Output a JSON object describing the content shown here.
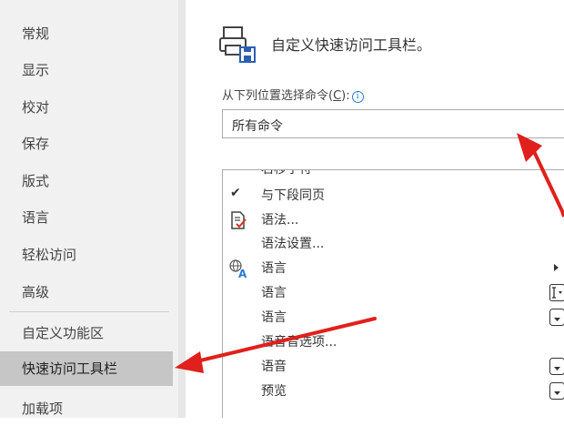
{
  "sidebar": {
    "items": [
      {
        "label": "常规"
      },
      {
        "label": "显示"
      },
      {
        "label": "校对"
      },
      {
        "label": "保存"
      },
      {
        "label": "版式"
      },
      {
        "label": "语言"
      },
      {
        "label": "轻松访问"
      },
      {
        "label": "高级"
      },
      {
        "label": "自定义功能区"
      },
      {
        "label": "快速访问工具栏",
        "selected": true
      },
      {
        "label": "加载项"
      }
    ]
  },
  "main": {
    "section_title": "自定义快速访问工具栏。",
    "choose_label": "从下列位置选择命令(C):",
    "choose_label_prefix": "从下列位置选择命令(",
    "choose_label_key": "C",
    "choose_label_suffix": "):",
    "dropdown_value": "所有命令",
    "commands": [
      {
        "label": "右移字符"
      },
      {
        "label": "与下段同页",
        "checked": true
      },
      {
        "label": "语法...",
        "icon": "grammar-icon"
      },
      {
        "label": "语法设置..."
      },
      {
        "label": "语言",
        "icon": "language-icon",
        "submenu": true
      },
      {
        "label": "语言",
        "control": "text-cursor-dropdown"
      },
      {
        "label": "语言",
        "control": "dropdown"
      },
      {
        "label": "语音音选项..."
      },
      {
        "label": "语音",
        "control": "dropdown"
      },
      {
        "label": "预览",
        "control": "dropdown"
      }
    ]
  },
  "colors": {
    "selected_bg": "#c6c6c6",
    "sidebar_bg": "#f1f1f1",
    "info_blue": "#2b79d0",
    "annotation_red": "#e0201c"
  }
}
